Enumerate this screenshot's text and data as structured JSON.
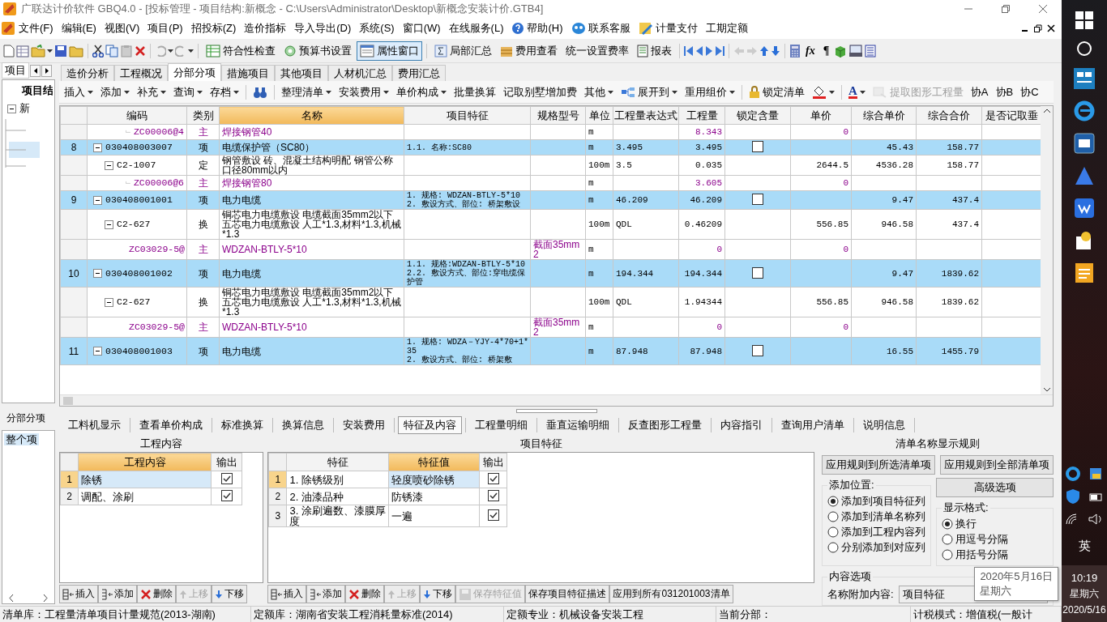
{
  "window": {
    "title": "广联达计价软件 GBQ4.0 - [投标管理 - 项目结构:新概念 - C:\\Users\\Administrator\\Desktop\\新概念安装计价.GTB4]"
  },
  "menu": [
    "文件(F)",
    "编辑(E)",
    "视图(V)",
    "项目(P)",
    "招投标(Z)",
    "造价指标",
    "导入导出(D)",
    "系统(S)",
    "窗口(W)",
    "在线服务(L)",
    "帮助(H)",
    "联系客服",
    "计量支付",
    "工期定额"
  ],
  "toolbar": [
    {
      "label": "符合性检查",
      "selected": false
    },
    {
      "label": "预算书设置",
      "selected": false
    },
    {
      "label": "属性窗口",
      "selected": true
    },
    {
      "label": "局部汇总",
      "selected": false
    },
    {
      "label": "费用查看",
      "selected": false
    },
    {
      "label": "统一设置费率",
      "selected": false
    },
    {
      "label": "报表",
      "selected": false
    }
  ],
  "format_tools": [
    "fx",
    "¶"
  ],
  "left_panel": {
    "tab": "项目",
    "tree_header": "项目结",
    "tree_root": "新",
    "section": "分部分项",
    "section_root": "整个项"
  },
  "tabs": [
    {
      "label": "造价分析",
      "selected": false
    },
    {
      "label": "工程概况",
      "selected": false
    },
    {
      "label": "分部分项",
      "selected": true
    },
    {
      "label": "措施项目",
      "selected": false
    },
    {
      "label": "其他项目",
      "selected": false
    },
    {
      "label": "人材机汇总",
      "selected": false
    },
    {
      "label": "费用汇总",
      "selected": false
    }
  ],
  "toolbar2": [
    {
      "kind": "text",
      "label": "插入",
      "dropdown": true,
      "disabled": false
    },
    {
      "kind": "text",
      "label": "添加",
      "dropdown": true,
      "disabled": false
    },
    {
      "kind": "text",
      "label": "补充",
      "dropdown": true,
      "disabled": false
    },
    {
      "kind": "text",
      "label": "查询",
      "dropdown": true,
      "disabled": false
    },
    {
      "kind": "text",
      "label": "存档",
      "dropdown": true,
      "disabled": false
    },
    {
      "kind": "icon",
      "dropdown": false,
      "disabled": false
    },
    {
      "kind": "text",
      "label": "整理清单",
      "dropdown": true,
      "disabled": false
    },
    {
      "kind": "text",
      "label": "安装费用",
      "dropdown": true,
      "disabled": false
    },
    {
      "kind": "text",
      "label": "单价构成",
      "dropdown": true,
      "disabled": false
    },
    {
      "kind": "text",
      "label": "批量换算",
      "dropdown": false,
      "disabled": false
    },
    {
      "kind": "text",
      "label": "记取别墅增加费",
      "dropdown": false,
      "disabled": false
    },
    {
      "kind": "text",
      "label": "其他",
      "dropdown": true,
      "disabled": false
    },
    {
      "kind": "text",
      "label": "展开到",
      "dropdown": true,
      "disabled": false
    },
    {
      "kind": "text",
      "label": "重用组价",
      "dropdown": true,
      "disabled": false
    },
    {
      "kind": "text",
      "label": "锁定清单",
      "dropdown": false,
      "disabled": false
    },
    {
      "kind": "icon",
      "dropdown": true,
      "disabled": false
    },
    {
      "kind": "glyph",
      "label": "A",
      "dropdown": true,
      "disabled": false
    },
    {
      "kind": "text",
      "label": "提取图形工程量",
      "dropdown": false,
      "disabled": true
    },
    {
      "kind": "text",
      "label": "协A",
      "dropdown": false,
      "disabled": false
    },
    {
      "kind": "text",
      "label": "协B",
      "dropdown": false,
      "disabled": false
    },
    {
      "kind": "text",
      "label": "协C",
      "dropdown": false,
      "disabled": false
    }
  ],
  "table": {
    "columns": [
      {
        "label": "编码",
        "selected": false
      },
      {
        "label": "类别",
        "selected": false
      },
      {
        "label": "名称",
        "selected": true
      },
      {
        "label": "项目特征",
        "selected": false
      },
      {
        "label": "规格型号",
        "selected": false
      },
      {
        "label": "单位",
        "selected": false
      },
      {
        "label": "工程量表达式",
        "selected": false
      },
      {
        "label": "工程量",
        "selected": false
      },
      {
        "label": "锁定含量",
        "selected": false
      },
      {
        "label": "单价",
        "selected": false
      },
      {
        "label": "综合单价",
        "selected": false
      },
      {
        "label": "综合合价",
        "selected": false
      },
      {
        "label": "是否记取垂",
        "selected": false
      }
    ],
    "rows": [
      {
        "kind": "material",
        "code": "ZC00006@4",
        "type": "主",
        "name": "焊接钢管40",
        "unit": "m",
        "qty": "8.343",
        "price": "0"
      },
      {
        "kind": "item",
        "no": "8",
        "code": "030408003007",
        "type": "项",
        "name": "电缆保护管（SC80）",
        "feature": [
          "1.1. 名称:SC80"
        ],
        "unit": "m",
        "expr": "3.495",
        "qty": "3.495",
        "locked": false,
        "unit_total": "45.43",
        "total": "158.77"
      },
      {
        "kind": "quota",
        "code": "C2-1007",
        "type": "定",
        "name": "钢管敷设 砖、混凝土结构明配 钢管公称口径80mm以内",
        "unit": "100m",
        "expr": "3.5",
        "qty": "0.035",
        "price": "2644.5",
        "unit_total": "4536.28",
        "total": "158.77"
      },
      {
        "kind": "material",
        "code": "ZC00006@6",
        "type": "主",
        "name": "焊接钢管80",
        "unit": "m",
        "qty": "3.605",
        "price": "0"
      },
      {
        "kind": "item",
        "no": "9",
        "code": "030408001001",
        "type": "项",
        "name": "电力电缆",
        "feature": [
          "1. 规格: WDZAN-BTLY-5*10",
          "2. 敷设方式、部位: 桥架敷设"
        ],
        "unit": "m",
        "expr": "46.209",
        "qty": "46.209",
        "locked": false,
        "unit_total": "9.47",
        "total": "437.4"
      },
      {
        "kind": "quota",
        "code": "C2-627",
        "type": "换",
        "name": "铜芯电力电缆敷设 电缆截面35mm2以下五芯电力电缆敷设 人工*1.3,材料*1.3,机械*1.3",
        "unit": "100m",
        "expr": "QDL",
        "qty": "0.46209",
        "price": "556.85",
        "unit_total": "946.58",
        "total": "437.4"
      },
      {
        "kind": "material",
        "code": "ZC03029-5@",
        "type": "主",
        "name": "WDZAN-BTLY-5*10",
        "spec": "截面35mm2",
        "unit": "m",
        "qty": "0",
        "price": "0"
      },
      {
        "kind": "item",
        "no": "10",
        "code": "030408001002",
        "type": "项",
        "name": "电力电缆",
        "feature": [
          "1.1. 规格:WDZAN-BTLY-5*10",
          "2.2. 敷设方式、部位:穿电缆保护管"
        ],
        "unit": "m",
        "expr": "194.344",
        "qty": "194.344",
        "locked": false,
        "unit_total": "9.47",
        "total": "1839.62"
      },
      {
        "kind": "quota",
        "code": "C2-627",
        "type": "换",
        "name": "铜芯电力电缆敷设 电缆截面35mm2以下五芯电力电缆敷设 人工*1.3,材料*1.3,机械*1.3",
        "unit": "100m",
        "expr": "QDL",
        "qty": "1.94344",
        "price": "556.85",
        "unit_total": "946.58",
        "total": "1839.62"
      },
      {
        "kind": "material",
        "code": "ZC03029-5@",
        "type": "主",
        "name": "WDZAN-BTLY-5*10",
        "spec": "截面35mm2",
        "unit": "m",
        "qty": "0",
        "price": "0"
      },
      {
        "kind": "item",
        "no": "11",
        "code": "030408001003",
        "type": "项",
        "name": "电力电缆",
        "feature": [
          "1. 规格: WDZA－YJY-4*70+1*35",
          "2. 敷设方式、部位: 桥架敷"
        ],
        "unit": "m",
        "expr": "87.948",
        "qty": "87.948",
        "locked": false,
        "unit_total": "16.55",
        "total": "1455.79"
      }
    ]
  },
  "lower_tabs": [
    {
      "label": "工料机显示",
      "selected": false
    },
    {
      "label": "查看单价构成",
      "selected": false
    },
    {
      "label": "标准换算",
      "selected": false
    },
    {
      "label": "换算信息",
      "selected": false
    },
    {
      "label": "安装费用",
      "selected": false
    },
    {
      "label": "特征及内容",
      "selected": true
    },
    {
      "label": "工程量明细",
      "selected": false
    },
    {
      "label": "垂直运输明细",
      "selected": false
    },
    {
      "label": "反查图形工程量",
      "selected": false
    },
    {
      "label": "内容指引",
      "selected": false
    },
    {
      "label": "查询用户清单",
      "selected": false
    },
    {
      "label": "说明信息",
      "selected": false
    }
  ],
  "work_content": {
    "title": "工程内容",
    "columns": [
      {
        "label": "工程内容",
        "selected": true
      },
      {
        "label": "输出",
        "selected": false
      }
    ],
    "rows": [
      {
        "no": "1",
        "text": "除锈",
        "output": true,
        "selected": true
      },
      {
        "no": "2",
        "text": "调配、涂刷",
        "output": true,
        "selected": false
      }
    ],
    "buttons": [
      {
        "label": "插入",
        "disabled": false
      },
      {
        "label": "添加",
        "disabled": false
      },
      {
        "label": "删除",
        "disabled": false
      },
      {
        "label": "上移",
        "disabled": true
      },
      {
        "label": "下移",
        "disabled": false
      }
    ]
  },
  "features": {
    "title": "项目特征",
    "columns": [
      {
        "label": "特征",
        "selected": false
      },
      {
        "label": "特征值",
        "selected": true
      },
      {
        "label": "输出",
        "selected": false
      }
    ],
    "rows": [
      {
        "no": "1",
        "feature": "1. 除锈级别",
        "value": "轻度喷砂除锈",
        "output": true,
        "selected": true
      },
      {
        "no": "2",
        "feature": "2. 油漆品种",
        "value": "防锈漆",
        "output": true,
        "selected": false
      },
      {
        "no": "3",
        "feature": "3. 涂刷遍数、漆膜厚度",
        "value": "一遍",
        "output": true,
        "selected": false
      }
    ],
    "buttons": [
      {
        "label": "插入",
        "disabled": false
      },
      {
        "label": "添加",
        "disabled": false
      },
      {
        "label": "删除",
        "disabled": false
      },
      {
        "label": "上移",
        "disabled": true
      },
      {
        "label": "下移",
        "disabled": false
      },
      {
        "label": "保存特征值",
        "disabled": true
      },
      {
        "label": "保存项目特征描述",
        "disabled": false
      },
      {
        "label": "应用到所有031201003清单",
        "disabled": false
      }
    ]
  },
  "name_rules": {
    "title": "清单名称显示规则",
    "buttons": [
      "应用规则到所选清单项",
      "应用规则到全部清单项"
    ],
    "advanced": "高级选项",
    "add_position": {
      "title": "添加位置:",
      "options": [
        {
          "label": "添加到项目特征列",
          "selected": true
        },
        {
          "label": "添加到清单名称列",
          "selected": false
        },
        {
          "label": "添加到工程内容列",
          "selected": false
        },
        {
          "label": "分别添加到对应列",
          "selected": false
        }
      ]
    },
    "display_format": {
      "title": "显示格式:",
      "options": [
        {
          "label": "换行",
          "selected": true
        },
        {
          "label": "用逗号分隔",
          "selected": false
        },
        {
          "label": "用括号分隔",
          "selected": false
        }
      ]
    },
    "content_options": {
      "title": "内容选项",
      "label": "名称附加内容:",
      "value": "项目特征"
    }
  },
  "tooltip": [
    "2020年5月16日",
    "星期六"
  ],
  "status_bar": [
    "清单库：工程量清单项目计量规范(2013-湖南)",
    "定额库：湖南省安装工程消耗量标准(2014)",
    "定额专业：机械设备安装工程",
    "当前分部：",
    "计税模式：增值税(一般计"
  ],
  "taskbar": {
    "ime": "英",
    "time": "10:19",
    "weekday": "星期六",
    "date": "2020/5/16"
  }
}
